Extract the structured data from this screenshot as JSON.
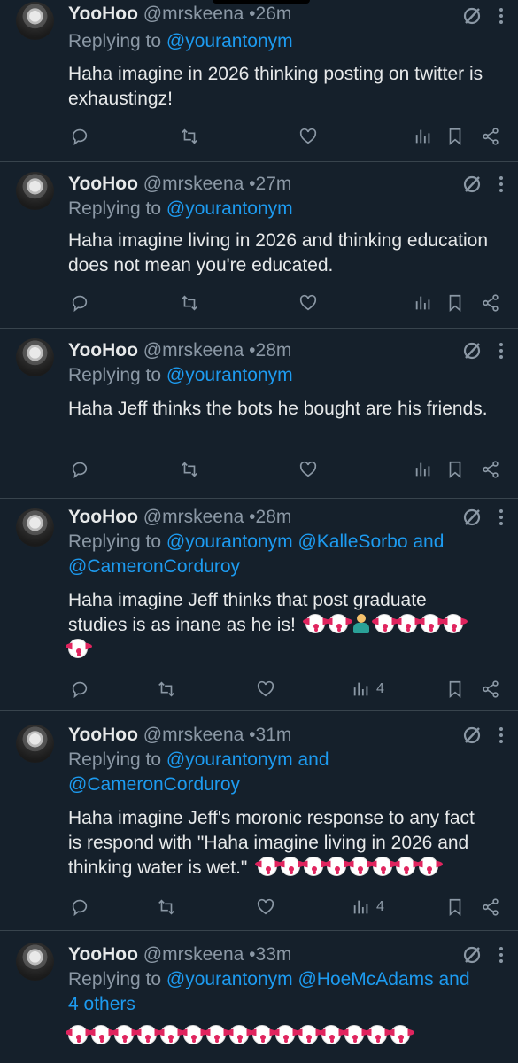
{
  "emoji_glyph": "🤡",
  "shrug_glyph": "🤷‍♂️",
  "tweets": [
    {
      "name": "YooHoo",
      "handle": "@mrskeena",
      "dot": "•",
      "time": "26m",
      "replying_prefix": "Replying to",
      "replying_links": [
        "@yourantonym"
      ],
      "replying_tail": "",
      "body": "Haha imagine in 2026 thinking posting on twitter is exhaustingz!",
      "views": ""
    },
    {
      "name": "YooHoo",
      "handle": "@mrskeena",
      "dot": "•",
      "time": "27m",
      "replying_prefix": "Replying to",
      "replying_links": [
        "@yourantonym"
      ],
      "replying_tail": "",
      "body": "Haha imagine living in 2026 and thinking education does not mean you're educated.",
      "views": ""
    },
    {
      "name": "YooHoo",
      "handle": "@mrskeena",
      "dot": "•",
      "time": "28m",
      "replying_prefix": "Replying to",
      "replying_links": [
        "@yourantonym"
      ],
      "replying_tail": "",
      "body": "Haha Jeff thinks the bots he bought are his friends.",
      "views": ""
    },
    {
      "name": "YooHoo",
      "handle": "@mrskeena",
      "dot": "•",
      "time": "28m",
      "replying_prefix": "Replying to",
      "replying_line1": "@yourantonym @KalleSorbo and",
      "replying_line2": "@CameronCorduroy",
      "body_line1": "Haha imagine Jeff thinks that post graduate",
      "body_line2": "studies is as inane as he is!",
      "views": "4"
    },
    {
      "name": "YooHoo",
      "handle": "@mrskeena",
      "dot": "•",
      "time": "31m",
      "replying_prefix": "Replying to",
      "replying_line1": "@yourantonym and",
      "replying_line2": "@CameronCorduroy",
      "body_line1": "Haha imagine Jeff's moronic response to any fact",
      "body_line2": "is respond with \"Haha imagine living in 2026 and",
      "body_line3": "thinking water is wet.\"",
      "views": "4"
    },
    {
      "name": "YooHoo",
      "handle": "@mrskeena",
      "dot": "•",
      "time": "33m",
      "replying_prefix": "Replying to",
      "replying_line1": "@yourantonym @HoeMcAdams and",
      "replying_line2": "4 others"
    }
  ],
  "icons": {
    "reply": "reply-icon",
    "retweet": "retweet-icon",
    "like": "like-icon",
    "views": "views-icon",
    "bookmark": "bookmark-icon",
    "share": "share-icon",
    "grok": "grok-icon",
    "more": "more-icon"
  },
  "colors": {
    "background": "#15202b",
    "text": "#e7e9ea",
    "muted": "#8b98a5",
    "link": "#1d9bf0",
    "divider": "#38444d"
  }
}
